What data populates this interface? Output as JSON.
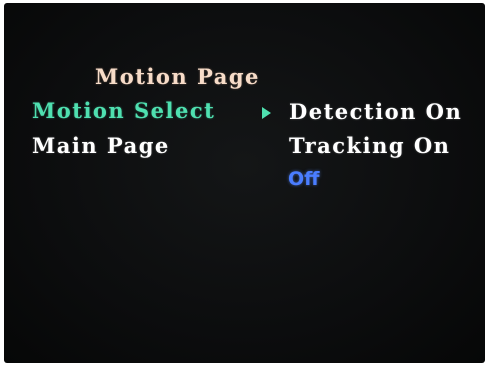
{
  "menu": {
    "title": "Motion Page",
    "items": [
      {
        "label": "Motion Select"
      },
      {
        "label": "Main Page"
      }
    ],
    "options": [
      {
        "label": "Detection On"
      },
      {
        "label": "Tracking On"
      },
      {
        "label": "Off"
      }
    ]
  },
  "colors": {
    "background": "#0c0d0e",
    "title": "#f7dcc8",
    "selected_item": "#4fe0b0",
    "normal_text": "#ffffff",
    "highlighted_option": "#4a7dff"
  },
  "icons": {
    "pointer": "right-triangle-icon"
  }
}
